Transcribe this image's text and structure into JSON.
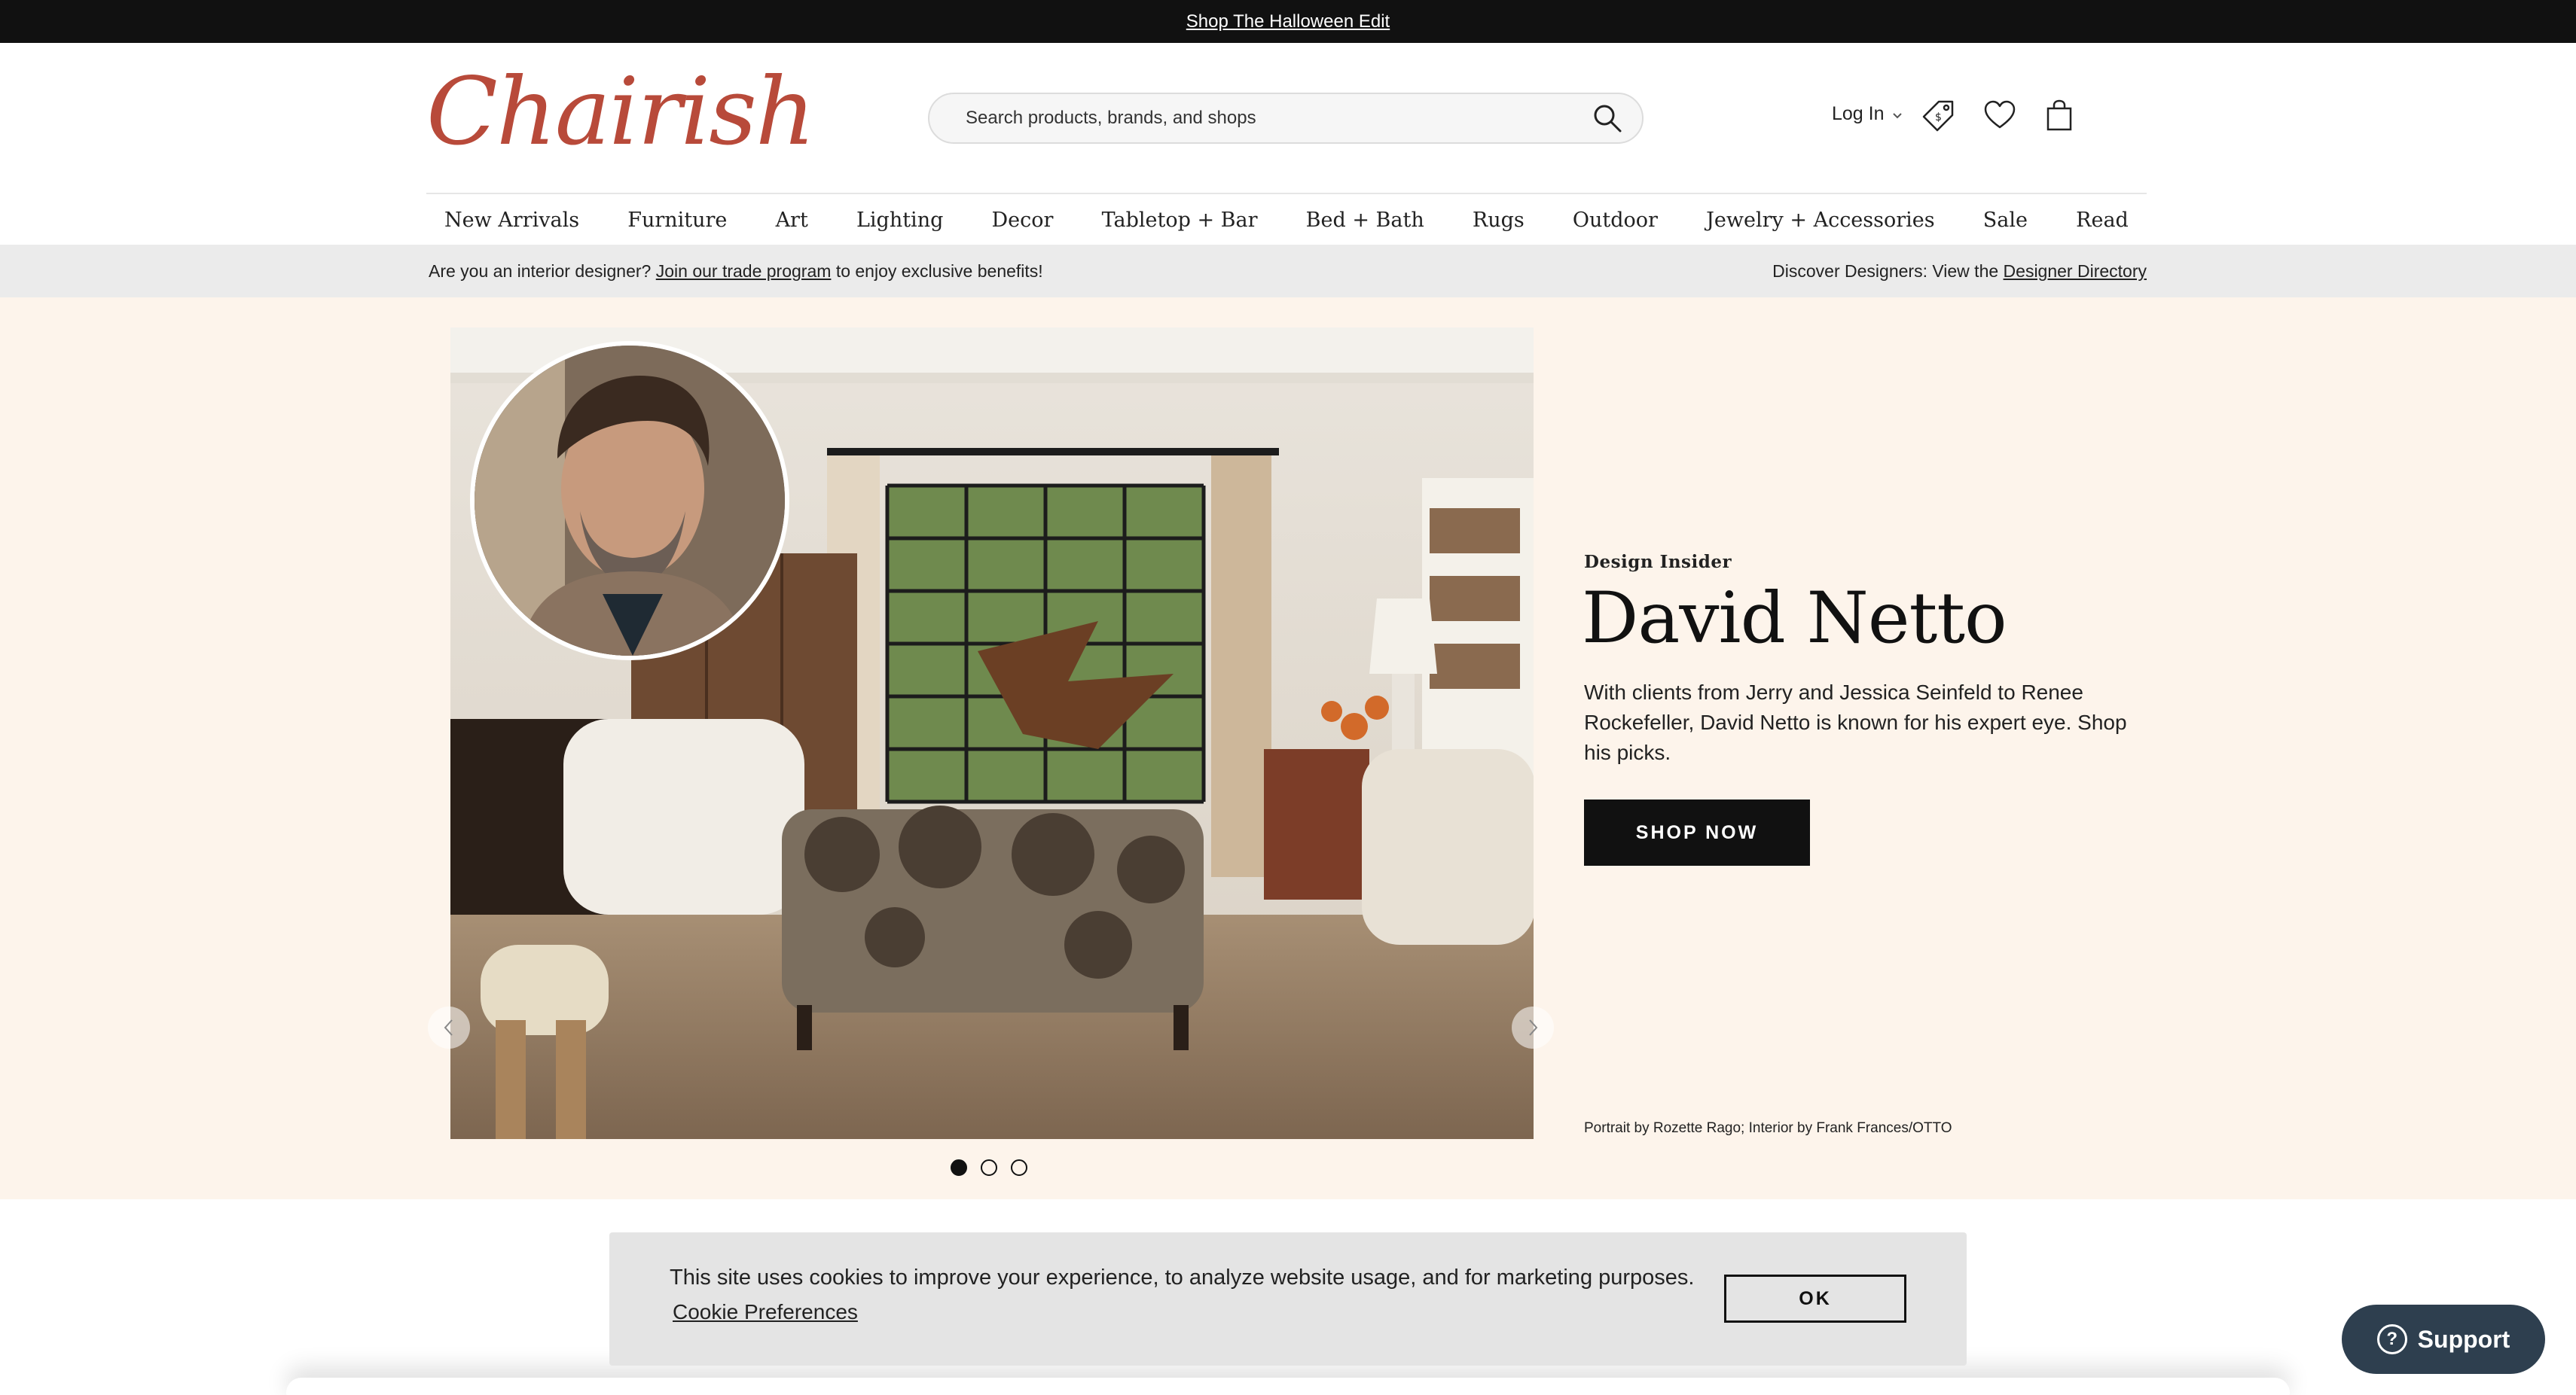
{
  "promo": {
    "label": "Shop The Halloween Edit"
  },
  "header": {
    "logo_text": "Chairish",
    "search": {
      "placeholder": "Search products, brands, and shops"
    },
    "login_label": "Log In",
    "icons": [
      "tag-icon",
      "heart-icon",
      "bag-icon"
    ]
  },
  "nav": {
    "items": [
      "New Arrivals",
      "Furniture",
      "Art",
      "Lighting",
      "Decor",
      "Tabletop + Bar",
      "Bed + Bath",
      "Rugs",
      "Outdoor",
      "Jewelry + Accessories",
      "Sale",
      "Read"
    ]
  },
  "trade": {
    "left_prefix": "Are you an interior designer?",
    "left_link": "Join our trade program",
    "left_suffix": "to enjoy exclusive benefits!",
    "right_prefix": "Discover Designers: View the",
    "right_link": "Designer Directory"
  },
  "hero": {
    "eyebrow": "Design Insider",
    "title": "David Netto",
    "description": "With clients from Jerry and Jessica Seinfeld to Renee Rockefeller, David Netto is known for his expert eye. Shop his picks.",
    "cta_label": "SHOP NOW",
    "credit": "Portrait by Rozette Rago; Interior by Frank Frances/OTTO",
    "slide_count": 3,
    "active_slide": 1
  },
  "cookie": {
    "message": "This site uses cookies to improve your experience, to analyze website usage, and for marketing purposes.",
    "preferences_label": "Cookie Preferences",
    "ok_label": "OK"
  },
  "support": {
    "label": "Support"
  },
  "colors": {
    "brand": "#b84a3a",
    "hero_bg": "#fdf4eb",
    "support_bg": "#2e3f4f",
    "dark": "#111111"
  }
}
